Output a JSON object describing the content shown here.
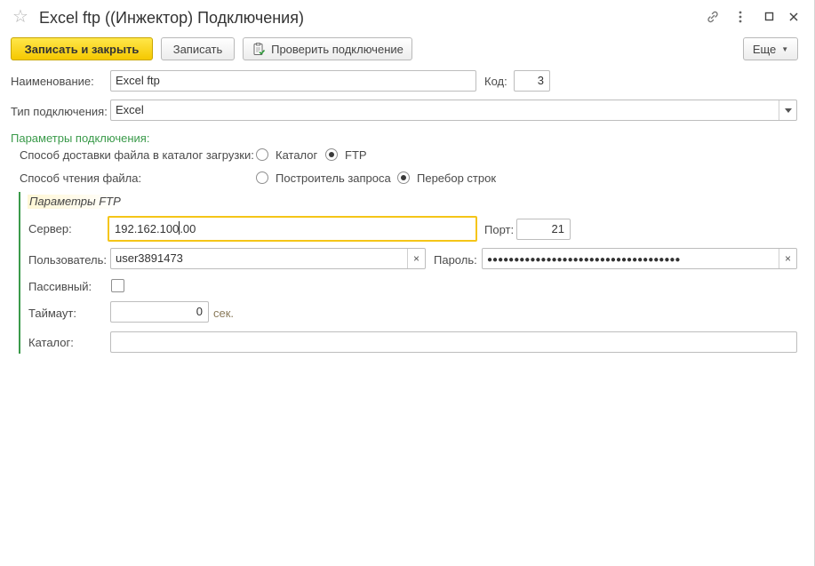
{
  "window": {
    "title": "Excel ftp ((Инжектор) Подключения)"
  },
  "toolbar": {
    "save_close_label": "Записать и закрыть",
    "save_label": "Записать",
    "check_connection_label": "Проверить подключение",
    "more_label": "Еще"
  },
  "form": {
    "name_label": "Наименование:",
    "name_value": "Excel ftp",
    "code_label": "Код:",
    "code_value": "3",
    "type_label": "Тип подключения:",
    "type_value": "Excel",
    "params_group_title": "Параметры подключения:",
    "delivery_label": "Способ доставки файла в каталог загрузки:",
    "delivery_options": [
      "Каталог",
      "FTP"
    ],
    "delivery_selected": "FTP",
    "read_label": "Способ чтения файла:",
    "read_options": [
      "Построитель запроса",
      "Перебор строк"
    ],
    "read_selected": "Перебор строк"
  },
  "ftp": {
    "group_title": "Параметры FTP",
    "server_label": "Сервер:",
    "server_value_before_cursor": "192.162.100",
    "server_value_after_cursor": ".00",
    "port_label": "Порт:",
    "port_value": "21",
    "user_label": "Пользователь:",
    "user_value": "user3891473",
    "password_label": "Пароль:",
    "password_value": "●●●●●●●●●●●●●●●●●●●●●●●●●●●●●●●●●●●●",
    "passive_label": "Пассивный:",
    "passive_checked": false,
    "timeout_label": "Таймаут:",
    "timeout_value": "0",
    "timeout_unit": "сек.",
    "catalog_label": "Каталог:",
    "catalog_value": ""
  },
  "colors": {
    "accent_yellow": "#f5c800",
    "group_green": "#3a9a4a",
    "focus_border": "#f5c518"
  }
}
